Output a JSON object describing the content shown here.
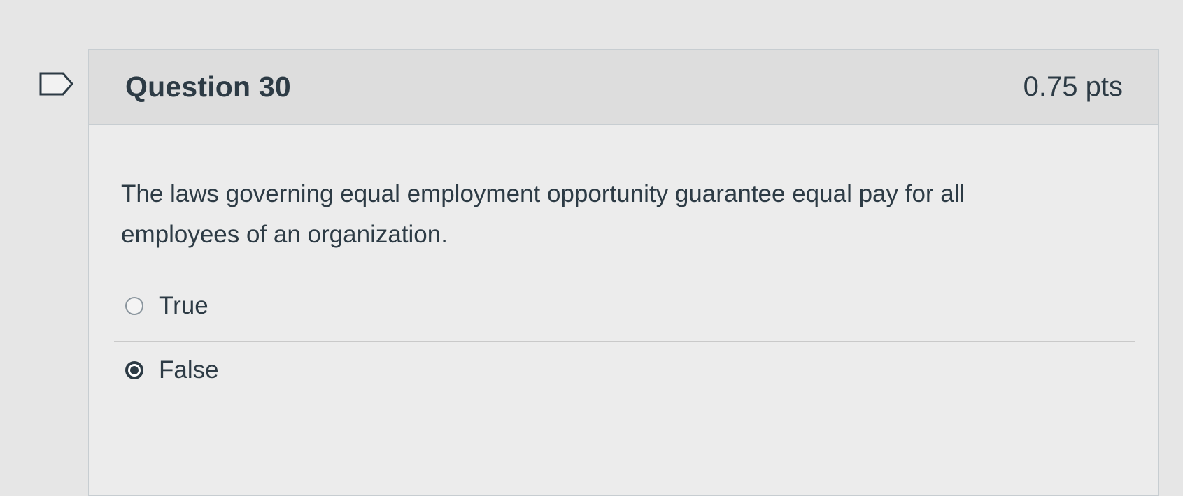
{
  "question": {
    "title": "Question 30",
    "points": "0.75 pts",
    "text": "The laws governing equal employment opportunity guarantee equal pay for all employees of an organization.",
    "flag_icon": "bookmark-flag-icon"
  },
  "answers": [
    {
      "label": "True",
      "selected": false
    },
    {
      "label": "False",
      "selected": true
    }
  ]
}
